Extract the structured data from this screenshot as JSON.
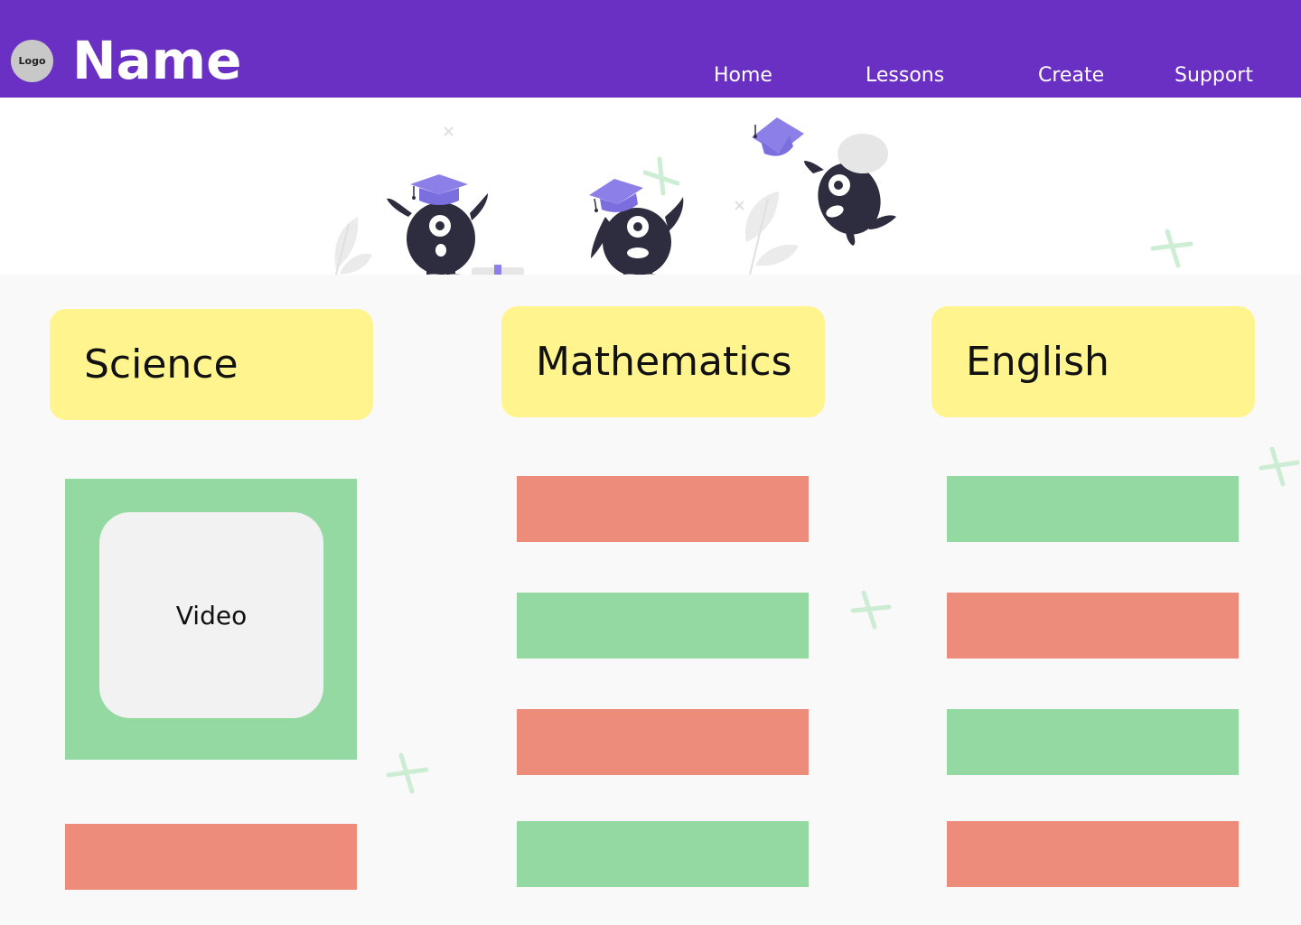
{
  "header": {
    "logo_label": "Logo",
    "brand_name": "Name",
    "nav": [
      "Home",
      "Lessons",
      "Create",
      "Support"
    ]
  },
  "subjects": [
    {
      "label": "Science"
    },
    {
      "label": "Mathematics"
    },
    {
      "label": "English"
    }
  ],
  "science": {
    "video_label": "Video"
  },
  "colors": {
    "header_bg": "#6a2fc3",
    "subject_card": "#fff48e",
    "tile_green": "#94d9a2",
    "tile_red": "#ee8c7c",
    "video_box": "#f2f2f2",
    "page_bg": "#f9f9f9"
  },
  "mathematics_tiles": [
    "red",
    "green",
    "red",
    "green"
  ],
  "english_tiles": [
    "green",
    "red",
    "green",
    "red"
  ]
}
